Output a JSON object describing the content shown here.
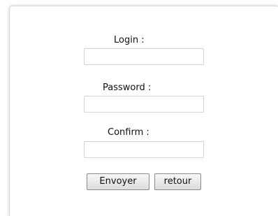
{
  "form": {
    "login_label": "Login :",
    "login_value": "",
    "password_label": "Password :",
    "password_value": "",
    "confirm_label": "Confirm :",
    "confirm_value": "",
    "submit_label": "Envoyer",
    "back_label": "retour"
  }
}
